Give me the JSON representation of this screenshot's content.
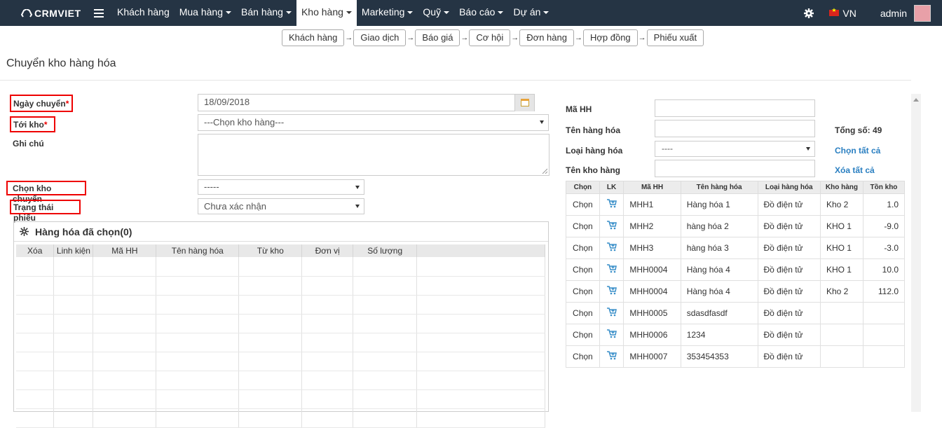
{
  "brand": {
    "name": "CRMVIET"
  },
  "nav": {
    "items": [
      {
        "label": "Khách hàng",
        "dropdown": false,
        "active": false
      },
      {
        "label": "Mua hàng",
        "dropdown": true,
        "active": false
      },
      {
        "label": "Bán hàng",
        "dropdown": true,
        "active": false
      },
      {
        "label": "Kho hàng",
        "dropdown": true,
        "active": true
      },
      {
        "label": "Marketing",
        "dropdown": true,
        "active": false
      },
      {
        "label": "Quỹ",
        "dropdown": true,
        "active": false
      },
      {
        "label": "Báo cáo",
        "dropdown": true,
        "active": false
      },
      {
        "label": "Dự án",
        "dropdown": true,
        "active": false
      }
    ],
    "lang": "VN",
    "user": "admin"
  },
  "pipeline": [
    "Khách hàng",
    "Giao dịch",
    "Báo giá",
    "Cơ hội",
    "Đơn hàng",
    "Hợp đồng",
    "Phiếu xuất"
  ],
  "page": {
    "title": "Chuyển kho hàng hóa"
  },
  "form": {
    "date_label": "Ngày chuyển",
    "date_value": "18/09/2018",
    "to_label": "Tới kho",
    "to_value": "---Chọn kho hàng---",
    "note_label": "Ghi chú",
    "from_label": "Chọn kho chuyển",
    "from_value": "-----",
    "status_label": "Trạng thái phiếu",
    "status_value": "Chưa xác nhận",
    "required_mark": "*"
  },
  "selected": {
    "title": "Hàng hóa đã chọn(0)",
    "columns": [
      "Xóa",
      "Linh kiện",
      "Mã HH",
      "Tên hàng hóa",
      "Từ kho",
      "Đơn vị",
      "Số lượng",
      ""
    ]
  },
  "filter": {
    "code_label": "Mã HH",
    "name_label": "Tên hàng hóa",
    "type_label": "Loại hàng hóa",
    "type_value": "----",
    "wh_label": "Tên kho hàng",
    "total_label": "Tổng số: 49",
    "select_all": "Chọn tất cả",
    "clear_all": "Xóa tất cả"
  },
  "products": {
    "columns": [
      "Chọn",
      "LK",
      "Mã HH",
      "Tên hàng hóa",
      "Loại hàng hóa",
      "Kho hàng",
      "Tồn kho"
    ],
    "rows": [
      {
        "select": "Chọn",
        "code": "MHH1",
        "name": "Hàng hóa 1",
        "type": "Đồ điện tử",
        "wh": "Kho 2",
        "stock": "1.0"
      },
      {
        "select": "Chọn",
        "code": "MHH2",
        "name": "hàng hóa 2",
        "type": "Đồ điện tử",
        "wh": "KHO 1",
        "stock": "-9.0"
      },
      {
        "select": "Chọn",
        "code": "MHH3",
        "name": "hàng hóa 3",
        "type": "Đồ điện tử",
        "wh": "KHO 1",
        "stock": "-3.0"
      },
      {
        "select": "Chọn",
        "code": "MHH0004",
        "name": "Hàng hóa 4",
        "type": "Đồ điện tử",
        "wh": "KHO 1",
        "stock": "10.0"
      },
      {
        "select": "Chọn",
        "code": "MHH0004",
        "name": "Hàng hóa 4",
        "type": "Đồ điện tử",
        "wh": "Kho 2",
        "stock": "112.0"
      },
      {
        "select": "Chọn",
        "code": "MHH0005",
        "name": "sdasdfasdf",
        "type": "Đồ điện tử",
        "wh": "",
        "stock": ""
      },
      {
        "select": "Chọn",
        "code": "MHH0006",
        "name": "1234",
        "type": "Đồ điện tử",
        "wh": "",
        "stock": ""
      },
      {
        "select": "Chọn",
        "code": "MHH0007",
        "name": "353454353",
        "type": "Đồ điện tử",
        "wh": "",
        "stock": ""
      }
    ]
  }
}
